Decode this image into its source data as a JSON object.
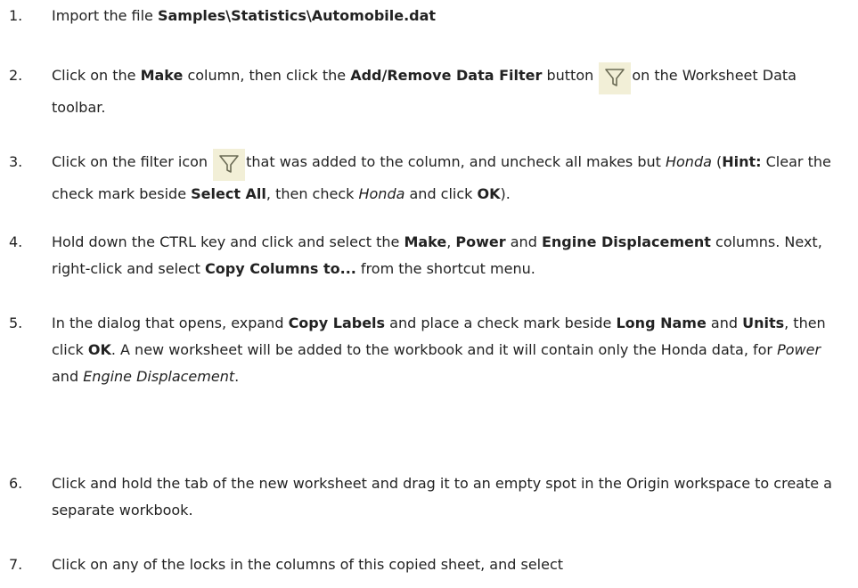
{
  "steps": [
    {
      "num": "1.",
      "parts": [
        {
          "t": "Import the file "
        },
        {
          "b": "Samples\\Statistics\\Automobile.dat"
        }
      ]
    },
    {
      "num": "2.",
      "parts": [
        {
          "t": "Click on the "
        },
        {
          "b": "Make"
        },
        {
          "t": " column, then click the "
        },
        {
          "b": "Add/Remove Data Filter"
        },
        {
          "t": " button "
        },
        {
          "icon": "filter-icon"
        },
        {
          "t": "on the Worksheet Data toolbar."
        }
      ]
    },
    {
      "num": "3.",
      "parts": [
        {
          "t": "Click on the filter icon "
        },
        {
          "icon": "filter-icon"
        },
        {
          "t": "that was added to the column, and uncheck all makes but "
        },
        {
          "i": "Honda"
        },
        {
          "t": " ("
        },
        {
          "b": "Hint:"
        },
        {
          "t": " Clear the check mark beside "
        },
        {
          "b": "Select All"
        },
        {
          "t": ", then check "
        },
        {
          "i": "Honda"
        },
        {
          "t": " and click "
        },
        {
          "b": "OK"
        },
        {
          "t": ")."
        }
      ]
    },
    {
      "num": "4.",
      "parts": [
        {
          "t": "Hold down the CTRL key and click and select the "
        },
        {
          "b": "Make"
        },
        {
          "t": ", "
        },
        {
          "b": "Power"
        },
        {
          "t": " and "
        },
        {
          "b": "Engine Displacement"
        },
        {
          "t": " columns. Next, right-click and select "
        },
        {
          "b": "Copy Columns to..."
        },
        {
          "t": " from the shortcut menu."
        }
      ]
    },
    {
      "num": "5.",
      "parts": [
        {
          "t": "In the dialog that opens, expand "
        },
        {
          "b": "Copy Labels"
        },
        {
          "t": " and place a check mark beside "
        },
        {
          "b": "Long Name"
        },
        {
          "t": " and "
        },
        {
          "b": "Units"
        },
        {
          "t": ", then click "
        },
        {
          "b": "OK"
        },
        {
          "t": ". A new worksheet will be added to the workbook and it will contain only the Honda data, for "
        },
        {
          "i": "Power"
        },
        {
          "t": " and "
        },
        {
          "i": "Engine Displacement"
        },
        {
          "t": "."
        }
      ]
    },
    {
      "num": "6.",
      "parts": [
        {
          "t": "Click and hold the tab of the new worksheet and drag it to an empty spot in the Origin workspace to create a separate workbook."
        }
      ]
    },
    {
      "num": "7.",
      "parts": [
        {
          "t": "Click on any of the locks in the columns of this copied sheet, and select"
        }
      ]
    }
  ],
  "colors": {
    "text": "#222222",
    "icon_bg": "#f2efd7",
    "icon_stroke": "#6b6b55"
  }
}
